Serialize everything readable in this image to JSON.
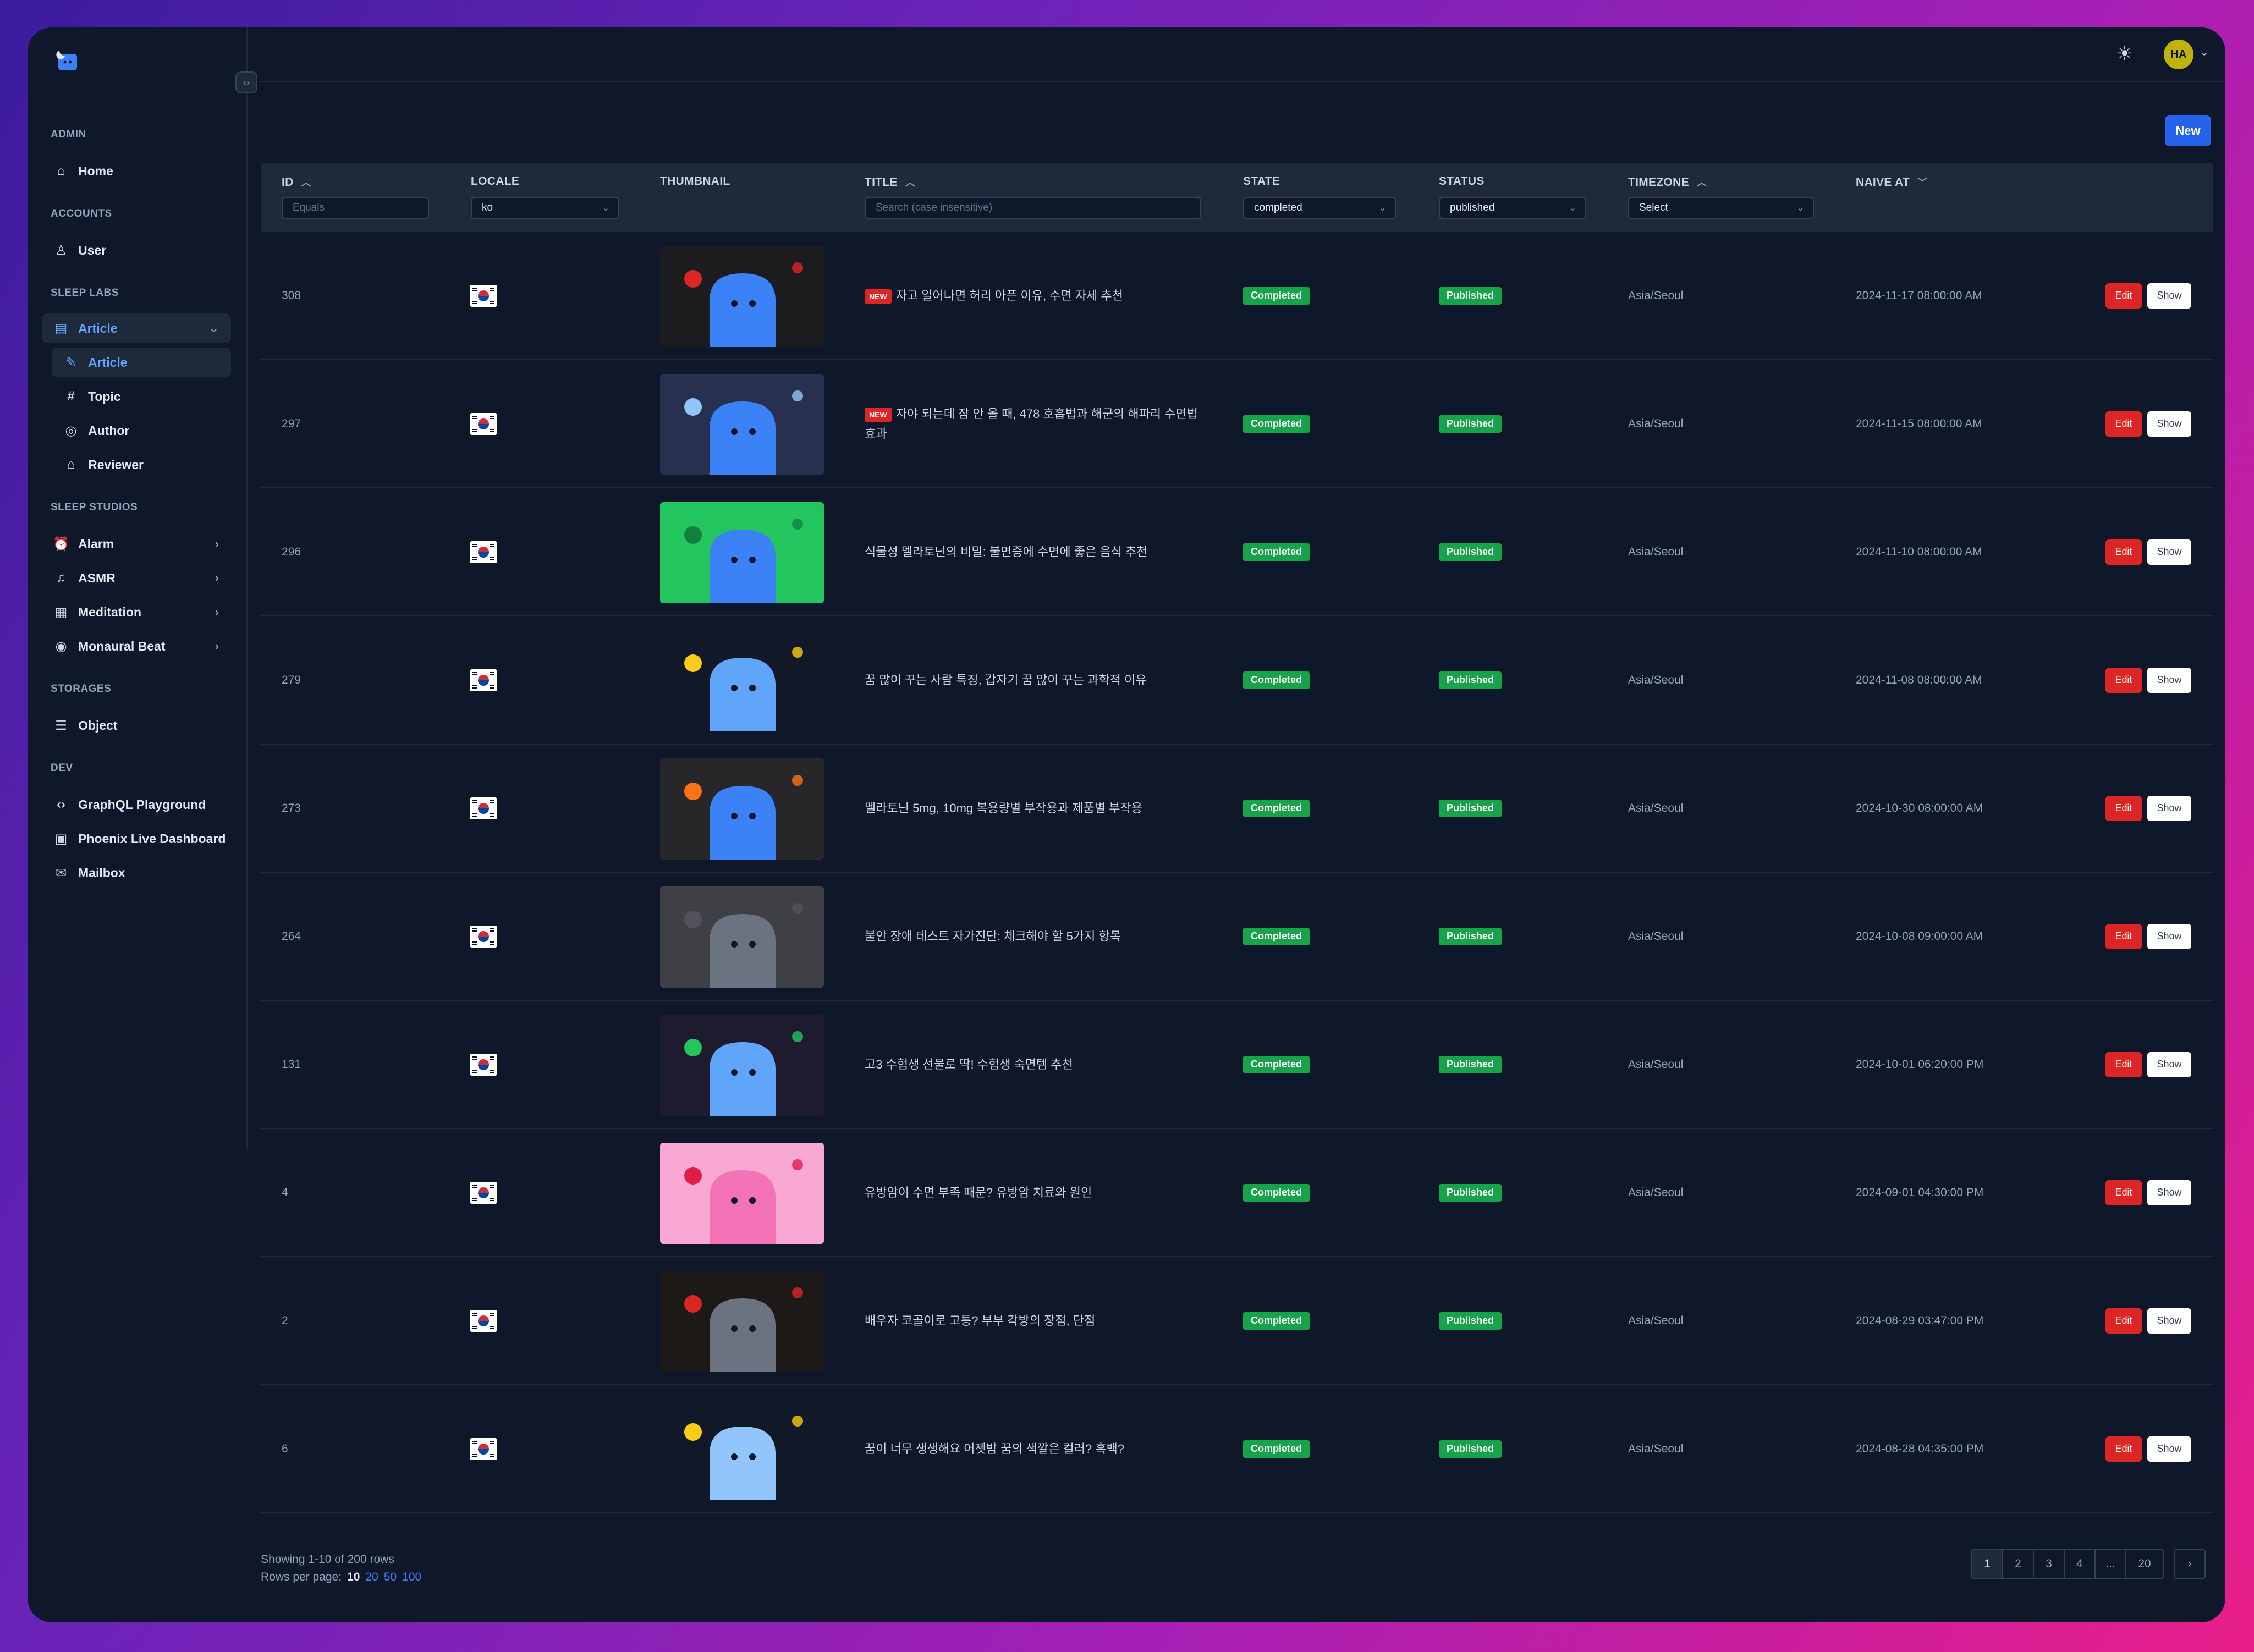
{
  "sidebar": {
    "sections": [
      {
        "label": "ADMIN",
        "items": [
          {
            "label": "Home",
            "icon": "home-icon"
          }
        ]
      },
      {
        "label": "ACCOUNTS",
        "items": [
          {
            "label": "User",
            "icon": "user-icon"
          }
        ]
      },
      {
        "label": "SLEEP LABS",
        "items": [
          {
            "label": "Article",
            "icon": "document-icon",
            "expanded": true,
            "children": [
              {
                "label": "Article",
                "icon": "pencil-square-icon",
                "active": true
              },
              {
                "label": "Topic",
                "icon": "hash-icon"
              },
              {
                "label": "Author",
                "icon": "user-circle-icon"
              },
              {
                "label": "Reviewer",
                "icon": "graduation-cap-icon"
              }
            ]
          }
        ]
      },
      {
        "label": "SLEEP STUDIOS",
        "items": [
          {
            "label": "Alarm",
            "icon": "alarm-icon"
          },
          {
            "label": "ASMR",
            "icon": "music-note-icon"
          },
          {
            "label": "Meditation",
            "icon": "calendar-icon"
          },
          {
            "label": "Monaural Beat",
            "icon": "signal-icon"
          }
        ]
      },
      {
        "label": "STORAGES",
        "items": [
          {
            "label": "Object",
            "icon": "database-icon"
          }
        ]
      },
      {
        "label": "DEV",
        "items": [
          {
            "label": "GraphQL Playground",
            "icon": "code-icon"
          },
          {
            "label": "Phoenix Live Dashboard",
            "icon": "dashboard-icon"
          },
          {
            "label": "Mailbox",
            "icon": "mail-icon"
          }
        ]
      }
    ]
  },
  "topbar": {
    "avatar_initials": "HA"
  },
  "toolbar": {
    "new_label": "New"
  },
  "table": {
    "columns": {
      "id": "ID",
      "locale": "LOCALE",
      "thumbnail": "THUMBNAIL",
      "title": "TITLE",
      "state": "STATE",
      "status": "STATUS",
      "timezone": "TIMEZONE",
      "naive_at": "NAIVE AT"
    },
    "filters": {
      "id_placeholder": "Equals",
      "locale": "ko",
      "title_placeholder": "Search (case insensitive)",
      "state": "completed",
      "status": "published",
      "timezone": "Select"
    },
    "new_tag": "NEW",
    "edit_label": "Edit",
    "show_label": "Show",
    "rows": [
      {
        "id": "308",
        "new": true,
        "title": "자고 일어나면 허리 아픈 이유, 수면 자세 추천",
        "state": "Completed",
        "status": "Published",
        "timezone": "Asia/Seoul",
        "naive_at": "2024-11-17 08:00:00 AM"
      },
      {
        "id": "297",
        "new": true,
        "title": "자야 되는데 잠 안 올 때, 478 호흡법과 해군의 해파리 수면법 효과",
        "state": "Completed",
        "status": "Published",
        "timezone": "Asia/Seoul",
        "naive_at": "2024-11-15 08:00:00 AM"
      },
      {
        "id": "296",
        "new": false,
        "title": "식물성 멜라토닌의 비밀: 불면증에 수면에 좋은 음식 추천",
        "state": "Completed",
        "status": "Published",
        "timezone": "Asia/Seoul",
        "naive_at": "2024-11-10 08:00:00 AM"
      },
      {
        "id": "279",
        "new": false,
        "title": "꿈 많이 꾸는 사람 특징, 갑자기 꿈 많이 꾸는 과학적 이유",
        "state": "Completed",
        "status": "Published",
        "timezone": "Asia/Seoul",
        "naive_at": "2024-11-08 08:00:00 AM"
      },
      {
        "id": "273",
        "new": false,
        "title": "멜라토닌 5mg, 10mg 복용량별 부작용과 제품별 부작용",
        "state": "Completed",
        "status": "Published",
        "timezone": "Asia/Seoul",
        "naive_at": "2024-10-30 08:00:00 AM"
      },
      {
        "id": "264",
        "new": false,
        "title": "불안 장애 테스트 자가진단: 체크해야 할 5가지 항목",
        "state": "Completed",
        "status": "Published",
        "timezone": "Asia/Seoul",
        "naive_at": "2024-10-08 09:00:00 AM"
      },
      {
        "id": "131",
        "new": false,
        "title": "고3 수험생 선물로 딱! 수험생 숙면템 추천",
        "state": "Completed",
        "status": "Published",
        "timezone": "Asia/Seoul",
        "naive_at": "2024-10-01 06:20:00 PM"
      },
      {
        "id": "4",
        "new": false,
        "title": "유방암이 수면 부족 때문? 유방암 치료와 원인",
        "state": "Completed",
        "status": "Published",
        "timezone": "Asia/Seoul",
        "naive_at": "2024-09-01 04:30:00 PM"
      },
      {
        "id": "2",
        "new": false,
        "title": "배우자 코골이로 고통? 부부 각방의 장점, 단점",
        "state": "Completed",
        "status": "Published",
        "timezone": "Asia/Seoul",
        "naive_at": "2024-08-29 03:47:00 PM"
      },
      {
        "id": "6",
        "new": false,
        "title": "꿈이 너무 생생해요 어젯밤 꿈의 색깔은 컬러? 흑백?",
        "state": "Completed",
        "status": "Published",
        "timezone": "Asia/Seoul",
        "naive_at": "2024-08-28 04:35:00 PM"
      }
    ]
  },
  "footer": {
    "showing": "Showing 1-10 of 200 rows",
    "rows_per_page_label": "Rows per page:",
    "rows_per_page_options": [
      "10",
      "20",
      "50",
      "100"
    ],
    "pages": [
      "1",
      "2",
      "3",
      "4",
      "...",
      "20"
    ],
    "next_icon": "chevron-right-icon"
  }
}
